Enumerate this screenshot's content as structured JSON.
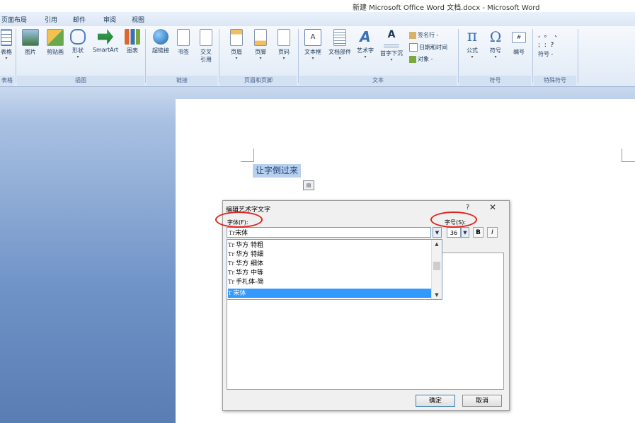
{
  "window": {
    "title": "新建 Microsoft Office Word 文档.docx - Microsoft Word"
  },
  "tabs": [
    "页面布局",
    "引用",
    "邮件",
    "审阅",
    "视图"
  ],
  "ribbon": {
    "groups": [
      {
        "label": "表格",
        "buttons": [
          {
            "label": "表格"
          }
        ]
      },
      {
        "label": "插图",
        "buttons": [
          {
            "label": "图片"
          },
          {
            "label": "剪贴画"
          },
          {
            "label": "形状"
          },
          {
            "label": "SmartArt"
          },
          {
            "label": "图表"
          }
        ]
      },
      {
        "label": "链接",
        "buttons": [
          {
            "label": "超链接"
          },
          {
            "label": "书签"
          },
          {
            "label": "交叉引用"
          }
        ]
      },
      {
        "label": "页眉和页脚",
        "buttons": [
          {
            "label": "页眉"
          },
          {
            "label": "页脚"
          },
          {
            "label": "页码"
          }
        ]
      },
      {
        "label": "文本",
        "buttons": [
          {
            "label": "文本框"
          },
          {
            "label": "文档部件"
          },
          {
            "label": "艺术字"
          },
          {
            "label": "首字下沉"
          }
        ],
        "small_buttons": [
          {
            "label": "签名行 -"
          },
          {
            "label": "日期和时间"
          },
          {
            "label": "对象 -"
          }
        ]
      },
      {
        "label": "符号",
        "buttons": [
          {
            "label": "公式"
          },
          {
            "label": "符号"
          },
          {
            "label": "编号"
          }
        ]
      },
      {
        "label": "特殊符号",
        "buttons": [
          {
            "label": "符号 -"
          }
        ]
      }
    ]
  },
  "document": {
    "selected_text": "让字倒过来"
  },
  "dialog": {
    "title": "编辑艺术字文字",
    "help": "?",
    "close": "✕",
    "font_label": "字体(F):",
    "size_label": "字号(S):",
    "font_value": "宋体",
    "size_value": "36",
    "bold": "B",
    "italic": "I",
    "font_list": [
      "华方 特粗",
      "华方 特细",
      "华方 细体",
      "华方 中等",
      "手札体-简",
      "宋体"
    ],
    "selected_font_index": 5,
    "ok_label": "确定",
    "cancel_label": "取消"
  },
  "colors": {
    "annotation": "#e0221c",
    "selection": "#3399ff"
  }
}
